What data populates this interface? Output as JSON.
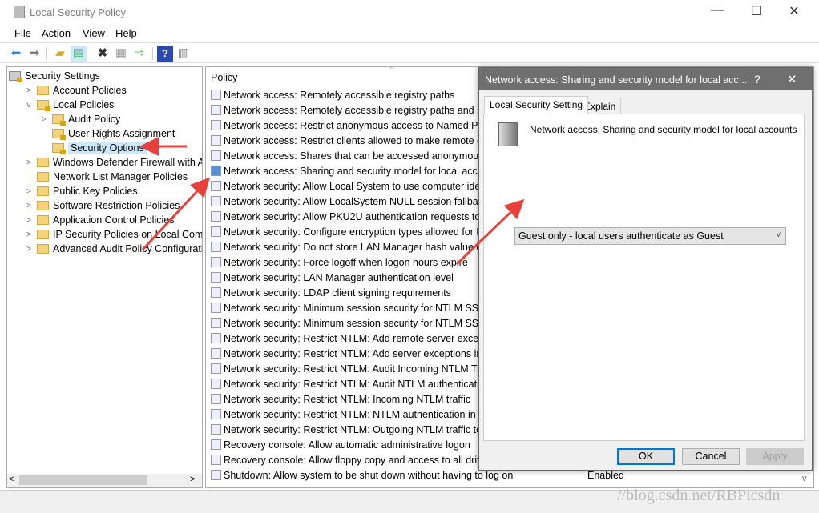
{
  "window": {
    "title": "Local Security Policy",
    "minimize": "—",
    "maximize": "☐",
    "close": "✕"
  },
  "menu": [
    "File",
    "Action",
    "View",
    "Help"
  ],
  "toolbar": [
    "back-icon",
    "forward-icon",
    "up-folder-icon",
    "show-hide-tree-icon",
    "delete-icon",
    "properties-icon",
    "export-list-icon",
    "help-icon",
    "show-action-pane-icon"
  ],
  "tree": [
    {
      "label": "Security Settings",
      "level": 0,
      "expander": ""
    },
    {
      "label": "Account Policies",
      "level": 1,
      "expander": ">"
    },
    {
      "label": "Local Policies",
      "level": 1,
      "expander": "v"
    },
    {
      "label": "Audit Policy",
      "level": 2,
      "expander": ">"
    },
    {
      "label": "User Rights Assignment",
      "level": 2,
      "expander": ""
    },
    {
      "label": "Security Options",
      "level": 2,
      "expander": "",
      "selected": true
    },
    {
      "label": "Windows Defender Firewall with Adva",
      "level": 1,
      "expander": ">"
    },
    {
      "label": "Network List Manager Policies",
      "level": 1,
      "expander": ""
    },
    {
      "label": "Public Key Policies",
      "level": 1,
      "expander": ">"
    },
    {
      "label": "Software Restriction Policies",
      "level": 1,
      "expander": ">"
    },
    {
      "label": "Application Control Policies",
      "level": 1,
      "expander": ">"
    },
    {
      "label": "IP Security Policies on Local Compute",
      "level": 1,
      "expander": ">"
    },
    {
      "label": "Advanced Audit Policy Configuration",
      "level": 1,
      "expander": ">"
    }
  ],
  "list": {
    "column_policy": "Policy",
    "rows": [
      {
        "policy": "Network access: Remotely accessible registry paths",
        "setting": ""
      },
      {
        "policy": "Network access: Remotely accessible registry paths and sub-",
        "setting": ""
      },
      {
        "policy": "Network access: Restrict anonymous access to Named Pipes",
        "setting": ""
      },
      {
        "policy": "Network access: Restrict clients allowed to make remote call",
        "setting": ""
      },
      {
        "policy": "Network access: Shares that can be accessed anonymously",
        "setting": ""
      },
      {
        "policy": "Network access: Sharing and security model for local accoun",
        "setting": "",
        "selected": true
      },
      {
        "policy": "Network security: Allow Local System to use computer ident",
        "setting": ""
      },
      {
        "policy": "Network security: Allow LocalSystem NULL session fallback",
        "setting": ""
      },
      {
        "policy": "Network security: Allow PKU2U authentication requests to th",
        "setting": ""
      },
      {
        "policy": "Network security: Configure encryption types allowed for Ke",
        "setting": ""
      },
      {
        "policy": "Network security: Do not store LAN Manager hash value on",
        "setting": ""
      },
      {
        "policy": "Network security: Force logoff when logon hours expire",
        "setting": ""
      },
      {
        "policy": "Network security: LAN Manager authentication level",
        "setting": ""
      },
      {
        "policy": "Network security: LDAP client signing requirements",
        "setting": ""
      },
      {
        "policy": "Network security: Minimum session security for NTLM SSP b",
        "setting": ""
      },
      {
        "policy": "Network security: Minimum session security for NTLM SSP b",
        "setting": ""
      },
      {
        "policy": "Network security: Restrict NTLM: Add remote server excepti",
        "setting": ""
      },
      {
        "policy": "Network security: Restrict NTLM: Add server exceptions in th",
        "setting": ""
      },
      {
        "policy": "Network security: Restrict NTLM: Audit Incoming NTLM Traf",
        "setting": ""
      },
      {
        "policy": "Network security: Restrict NTLM: Audit NTLM authentication",
        "setting": ""
      },
      {
        "policy": "Network security: Restrict NTLM: Incoming NTLM traffic",
        "setting": ""
      },
      {
        "policy": "Network security: Restrict NTLM: NTLM authentication in th",
        "setting": ""
      },
      {
        "policy": "Network security: Restrict NTLM: Outgoing NTLM traffic to r",
        "setting": ""
      },
      {
        "policy": "Recovery console: Allow automatic administrative logon",
        "setting": ""
      },
      {
        "policy": "Recovery console: Allow floppy copy and access to all drives",
        "setting": ""
      },
      {
        "policy": "Shutdown: Allow system to be shut down without having to log on",
        "setting": "Enabled"
      }
    ]
  },
  "dialog": {
    "title": "Network access: Sharing and security model for local acc...",
    "help": "?",
    "close": "✕",
    "tabs": [
      "Local Security Setting",
      "Explain"
    ],
    "policy_name": "Network access: Sharing and security model for local accounts",
    "selected_value": "Guest only - local users authenticate as Guest",
    "ok": "OK",
    "cancel": "Cancel",
    "apply": "Apply"
  },
  "watermark": "//blog.csdn.net/RBPicsdn",
  "colors": {
    "annotation_arrow": "#e8403a",
    "selection": "#cce8ff",
    "dialog_title": "#6f6f6f",
    "default_button_border": "#0078d7"
  }
}
